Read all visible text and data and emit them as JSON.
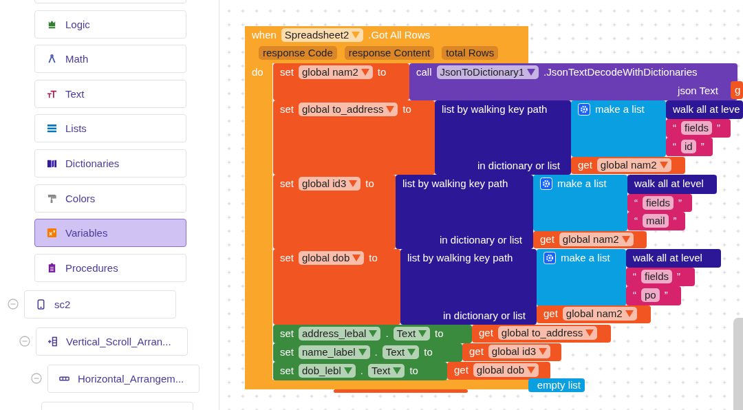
{
  "sidebar": {
    "categories": [
      {
        "label": "Logic",
        "selected": false
      },
      {
        "label": "Math",
        "selected": false
      },
      {
        "label": "Text",
        "selected": false
      },
      {
        "label": "Lists",
        "selected": false
      },
      {
        "label": "Dictionaries",
        "selected": false
      },
      {
        "label": "Colors",
        "selected": false
      },
      {
        "label": "Variables",
        "selected": true
      },
      {
        "label": "Procedures",
        "selected": false
      }
    ],
    "tree": [
      {
        "label": "sc2",
        "expanded": true,
        "children": [
          {
            "label": "Vertical_Scroll_Arran...",
            "expanded": true,
            "children": [
              {
                "label": "Horizontal_Arrangem...",
                "expanded": true
              }
            ]
          }
        ]
      }
    ]
  },
  "blocks": [
    {
      "kind": "event",
      "keyword": "when",
      "component": "Spreadsheet2",
      "event_name": ".Got All Rows",
      "params": [
        "response Code",
        "response Content",
        "total Rows"
      ],
      "do_label": "do"
    },
    {
      "kind": "set_var",
      "rows": [
        [
          {
            "kind": "label",
            "text": "set"
          },
          {
            "kind": "dropdown",
            "text": "global nam2"
          },
          {
            "kind": "label",
            "text": "to"
          }
        ]
      ]
    },
    {
      "kind": "call",
      "rows": [
        [
          {
            "kind": "label",
            "text": "call"
          },
          {
            "kind": "dropdown",
            "text": "JsonToDictionary1"
          },
          {
            "kind": "label",
            "text": ".JsonTextDecodeWithDictionaries"
          }
        ],
        [
          {
            "kind": "label",
            "text": "json Text"
          }
        ]
      ]
    },
    {
      "kind": "get",
      "rows": [
        [
          {
            "kind": "label",
            "text": "g"
          }
        ]
      ]
    },
    {
      "kind": "set_var",
      "rows": [
        [
          {
            "kind": "label",
            "text": "set"
          },
          {
            "kind": "dropdown",
            "text": "global to_address"
          },
          {
            "kind": "label",
            "text": "to"
          }
        ]
      ]
    },
    {
      "kind": "walk",
      "rows": [
        [
          {
            "kind": "label",
            "text": "list by walking key path"
          }
        ],
        [
          {
            "kind": "label",
            "text": "in dictionary or list"
          }
        ]
      ]
    },
    {
      "kind": "make_list",
      "rows": [
        [
          {
            "kind": "label",
            "text": "make a list"
          }
        ]
      ]
    },
    {
      "kind": "walk_all",
      "rows": [
        [
          {
            "kind": "label",
            "text": "walk all at leve"
          }
        ]
      ]
    },
    {
      "kind": "string",
      "rows": [
        [
          {
            "kind": "label",
            "text": "“"
          },
          {
            "kind": "field",
            "text": "fields"
          },
          {
            "kind": "label",
            "text": "”"
          }
        ]
      ]
    },
    {
      "kind": "string",
      "rows": [
        [
          {
            "kind": "label",
            "text": "“"
          },
          {
            "kind": "field",
            "text": "id"
          },
          {
            "kind": "label",
            "text": "”"
          }
        ]
      ]
    },
    {
      "kind": "get",
      "rows": [
        [
          {
            "kind": "label",
            "text": "get"
          },
          {
            "kind": "dropdown",
            "text": "global nam2"
          }
        ]
      ]
    },
    {
      "kind": "set_var",
      "rows": [
        [
          {
            "kind": "label",
            "text": "set"
          },
          {
            "kind": "dropdown",
            "text": "global id3"
          },
          {
            "kind": "label",
            "text": "to"
          }
        ]
      ]
    },
    {
      "kind": "walk",
      "rows": [
        [
          {
            "kind": "label",
            "text": "list by walking key path"
          }
        ],
        [
          {
            "kind": "label",
            "text": "in dictionary or list"
          }
        ]
      ]
    },
    {
      "kind": "make_list",
      "rows": [
        [
          {
            "kind": "label",
            "text": "make a list"
          }
        ]
      ]
    },
    {
      "kind": "walk_all",
      "rows": [
        [
          {
            "kind": "label",
            "text": "walk all at level"
          }
        ]
      ]
    },
    {
      "kind": "string",
      "rows": [
        [
          {
            "kind": "label",
            "text": "“"
          },
          {
            "kind": "field",
            "text": "fields"
          },
          {
            "kind": "label",
            "text": "”"
          }
        ]
      ]
    },
    {
      "kind": "string",
      "rows": [
        [
          {
            "kind": "label",
            "text": "“"
          },
          {
            "kind": "field",
            "text": "mail"
          },
          {
            "kind": "label",
            "text": "”"
          }
        ]
      ]
    },
    {
      "kind": "get",
      "rows": [
        [
          {
            "kind": "label",
            "text": "get"
          },
          {
            "kind": "dropdown",
            "text": "global nam2"
          }
        ]
      ]
    },
    {
      "kind": "set_var",
      "rows": [
        [
          {
            "kind": "label",
            "text": "set"
          },
          {
            "kind": "dropdown",
            "text": "global dob"
          },
          {
            "kind": "label",
            "text": "to"
          }
        ]
      ]
    },
    {
      "kind": "walk",
      "rows": [
        [
          {
            "kind": "label",
            "text": "list by walking key path"
          }
        ],
        [
          {
            "kind": "label",
            "text": "in dictionary or list"
          }
        ]
      ]
    },
    {
      "kind": "make_list",
      "rows": [
        [
          {
            "kind": "label",
            "text": "make a list"
          }
        ]
      ]
    },
    {
      "kind": "walk_all",
      "rows": [
        [
          {
            "kind": "label",
            "text": "walk all at level"
          }
        ]
      ]
    },
    {
      "kind": "string",
      "rows": [
        [
          {
            "kind": "label",
            "text": "“"
          },
          {
            "kind": "field",
            "text": "fields"
          },
          {
            "kind": "label",
            "text": "”"
          }
        ]
      ]
    },
    {
      "kind": "string",
      "rows": [
        [
          {
            "kind": "label",
            "text": "“"
          },
          {
            "kind": "field",
            "text": "po"
          },
          {
            "kind": "label",
            "text": "”"
          }
        ]
      ]
    },
    {
      "kind": "get",
      "rows": [
        [
          {
            "kind": "label",
            "text": "get"
          },
          {
            "kind": "dropdown",
            "text": "global nam2"
          }
        ]
      ]
    },
    {
      "kind": "set_prop",
      "rows": [
        [
          {
            "kind": "label",
            "text": "set"
          },
          {
            "kind": "dropdown",
            "text": "address_lebal"
          },
          {
            "kind": "label",
            "text": "."
          },
          {
            "kind": "dropdown",
            "text": "Text"
          },
          {
            "kind": "label",
            "text": "to"
          }
        ]
      ]
    },
    {
      "kind": "get",
      "rows": [
        [
          {
            "kind": "label",
            "text": "get"
          },
          {
            "kind": "dropdown",
            "text": "global to_address"
          }
        ]
      ]
    },
    {
      "kind": "set_prop",
      "rows": [
        [
          {
            "kind": "label",
            "text": "set"
          },
          {
            "kind": "dropdown",
            "text": "name_label"
          },
          {
            "kind": "label",
            "text": "."
          },
          {
            "kind": "dropdown",
            "text": "Text"
          },
          {
            "kind": "label",
            "text": "to"
          }
        ]
      ]
    },
    {
      "kind": "get",
      "rows": [
        [
          {
            "kind": "label",
            "text": "get"
          },
          {
            "kind": "dropdown",
            "text": "global id3"
          }
        ]
      ]
    },
    {
      "kind": "set_prop",
      "rows": [
        [
          {
            "kind": "label",
            "text": "set"
          },
          {
            "kind": "dropdown",
            "text": "dob_lebl"
          },
          {
            "kind": "label",
            "text": "."
          },
          {
            "kind": "dropdown",
            "text": "Text"
          },
          {
            "kind": "label",
            "text": "to"
          }
        ]
      ]
    },
    {
      "kind": "get",
      "rows": [
        [
          {
            "kind": "label",
            "text": "get"
          },
          {
            "kind": "dropdown",
            "text": "global dob"
          }
        ]
      ]
    },
    {
      "kind": "init"
    },
    {
      "kind": "empty_list",
      "rows": [
        [
          {
            "kind": "label",
            "text": "empty list"
          }
        ]
      ]
    }
  ]
}
